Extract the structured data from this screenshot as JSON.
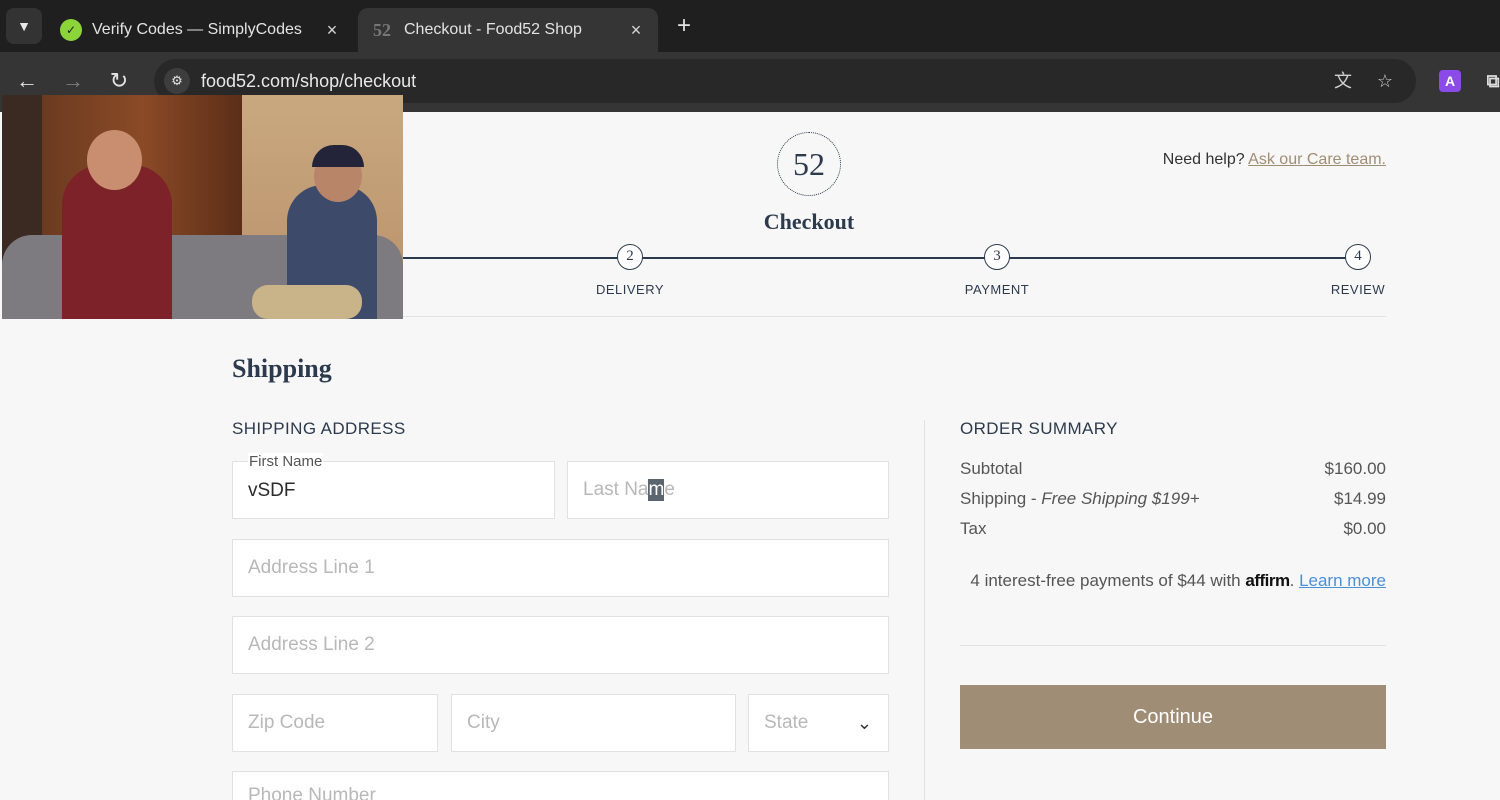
{
  "browser": {
    "tabs": [
      {
        "title": "Verify Codes — SimplyCodes",
        "close": "×"
      },
      {
        "title": "Checkout - Food52 Shop",
        "favicon_text": "52",
        "close": "×"
      }
    ],
    "new_tab": "+",
    "url": "food52.com/shop/checkout",
    "extension_label": "A"
  },
  "header": {
    "logo_text": "52",
    "title": "Checkout",
    "help_text": "Need help? ",
    "help_link": "Ask our Care team."
  },
  "steps": [
    {
      "number": "2",
      "label": "DELIVERY"
    },
    {
      "number": "3",
      "label": "PAYMENT"
    },
    {
      "number": "4",
      "label": "REVIEW"
    }
  ],
  "shipping": {
    "heading": "Shipping",
    "section_title": "SHIPPING ADDRESS",
    "first_name_label": "First Name",
    "first_name_value": "vSDF",
    "last_name_placeholder_a": "Last Na",
    "last_name_placeholder_b": "m",
    "last_name_placeholder_c": "e",
    "address1_placeholder": "Address Line 1",
    "address2_placeholder": "Address Line 2",
    "zip_placeholder": "Zip Code",
    "city_placeholder": "City",
    "state_placeholder": "State",
    "phone_placeholder": "Phone Number"
  },
  "summary": {
    "title": "ORDER SUMMARY",
    "subtotal_label": "Subtotal",
    "subtotal_value": "$160.00",
    "shipping_label": "Shipping - ",
    "shipping_note": "Free Shipping $199+",
    "shipping_value": "$14.99",
    "tax_label": "Tax",
    "tax_value": "$0.00",
    "affirm_text": "4 interest-free payments of $44 with ",
    "affirm_brand": "affirm",
    "affirm_dot": ". ",
    "affirm_link": "Learn more",
    "continue_label": "Continue"
  }
}
